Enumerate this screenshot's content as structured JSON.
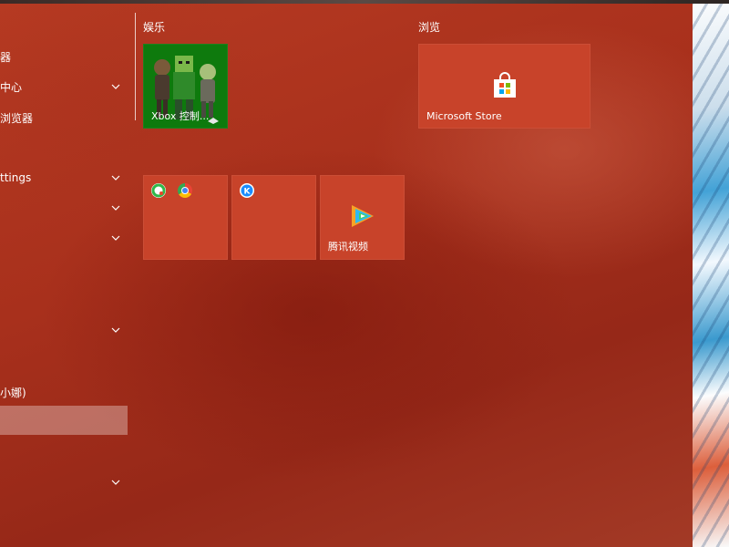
{
  "app_list": {
    "items": [
      {
        "label": "器",
        "has_chevron": false
      },
      {
        "label": "中心",
        "has_chevron": true
      },
      {
        "label": "浏览器",
        "has_chevron": false
      },
      {
        "label": "ttings",
        "has_chevron": true
      },
      {
        "label": "",
        "has_chevron": true
      },
      {
        "label": "",
        "has_chevron": true
      },
      {
        "label": "",
        "has_chevron": true
      },
      {
        "label": "小娜)",
        "has_chevron": false
      },
      {
        "label": "",
        "has_chevron": true
      }
    ]
  },
  "groups": {
    "entertainment": {
      "title": "娱乐",
      "xbox_tile": {
        "label": "Xbox 控制...",
        "icon": "xbox-companion-characters"
      }
    },
    "browse": {
      "title": "浏览",
      "store_tile": {
        "label": "Microsoft Store",
        "icon": "store-bag-icon"
      }
    },
    "folders": {
      "folder_tile_1": {
        "icons": [
          "qq-browser-icon",
          "chrome-icon"
        ]
      },
      "folder_tile_2": {
        "icons": [
          "kugou-icon"
        ]
      },
      "video_tile": {
        "label": "腾讯视频",
        "icon": "tencent-video-icon"
      }
    }
  },
  "colors": {
    "menu_bg": "#a8301c",
    "tile": "#c8432a",
    "xbox_green": "#0e7a0d"
  }
}
